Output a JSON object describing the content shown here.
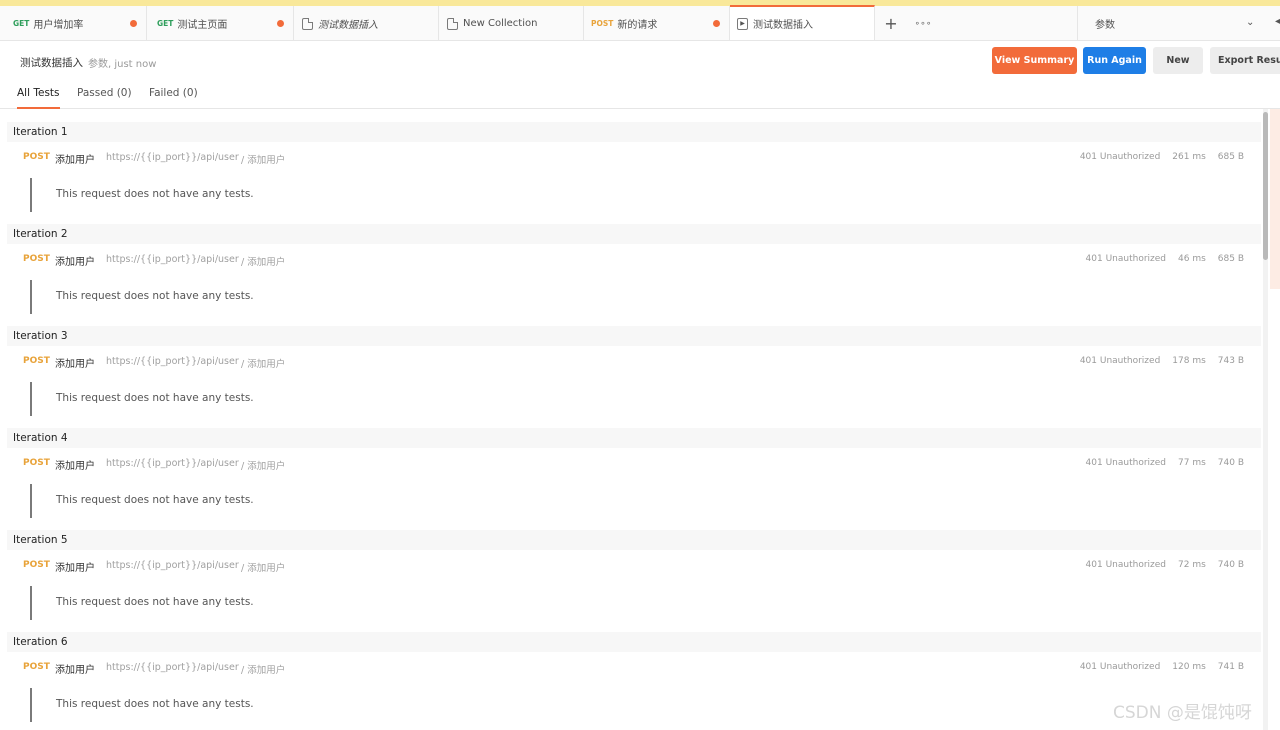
{
  "tabs": [
    {
      "method": "GET",
      "label": "用户增加率",
      "unsaved": true
    },
    {
      "method": "GET",
      "label": "测试主页面",
      "unsaved": true
    },
    {
      "icon": "document-icon",
      "label": "测试数据插入",
      "italic": true
    },
    {
      "icon": "document-icon",
      "label": "New Collection"
    },
    {
      "method": "POST",
      "label": "新的请求",
      "unsaved": true
    },
    {
      "icon": "runner-icon",
      "label": "测试数据插入",
      "active": true
    }
  ],
  "tab_controls": {
    "add": "+",
    "more": "∘∘∘"
  },
  "environment": {
    "selected": "参数"
  },
  "run": {
    "title": "测试数据插入",
    "meta": "参数, just now"
  },
  "buttons": {
    "view_summary": "View Summary",
    "run_again": "Run Again",
    "new": "New",
    "export": "Export Results"
  },
  "filter_tabs": [
    {
      "label": "All Tests",
      "active": true
    },
    {
      "label": "Passed (0)"
    },
    {
      "label": "Failed (0)"
    }
  ],
  "iterations": [
    {
      "label": "Iteration 1",
      "method": "POST",
      "name": "添加用户",
      "url": "https://{{ip_port}}/api/user",
      "folder": "/ 添加用户",
      "status": "401 Unauthorized",
      "time": "261 ms",
      "size": "685 B",
      "message": "This request does not have any tests."
    },
    {
      "label": "Iteration 2",
      "method": "POST",
      "name": "添加用户",
      "url": "https://{{ip_port}}/api/user",
      "folder": "/ 添加用户",
      "status": "401 Unauthorized",
      "time": "46 ms",
      "size": "685 B",
      "message": "This request does not have any tests."
    },
    {
      "label": "Iteration 3",
      "method": "POST",
      "name": "添加用户",
      "url": "https://{{ip_port}}/api/user",
      "folder": "/ 添加用户",
      "status": "401 Unauthorized",
      "time": "178 ms",
      "size": "743 B",
      "message": "This request does not have any tests."
    },
    {
      "label": "Iteration 4",
      "method": "POST",
      "name": "添加用户",
      "url": "https://{{ip_port}}/api/user",
      "folder": "/ 添加用户",
      "status": "401 Unauthorized",
      "time": "77 ms",
      "size": "740 B",
      "message": "This request does not have any tests."
    },
    {
      "label": "Iteration 5",
      "method": "POST",
      "name": "添加用户",
      "url": "https://{{ip_port}}/api/user",
      "folder": "/ 添加用户",
      "status": "401 Unauthorized",
      "time": "72 ms",
      "size": "740 B",
      "message": "This request does not have any tests."
    },
    {
      "label": "Iteration 6",
      "method": "POST",
      "name": "添加用户",
      "url": "https://{{ip_port}}/api/user",
      "folder": "/ 添加用户",
      "status": "401 Unauthorized",
      "time": "120 ms",
      "size": "741 B",
      "message": "This request does not have any tests."
    }
  ],
  "watermark": "CSDN @是馄饨呀",
  "colors": {
    "accent": "#f26b3a",
    "primary": "#1e7ee6",
    "get": "#2e9e5b",
    "post": "#e8a33a"
  }
}
